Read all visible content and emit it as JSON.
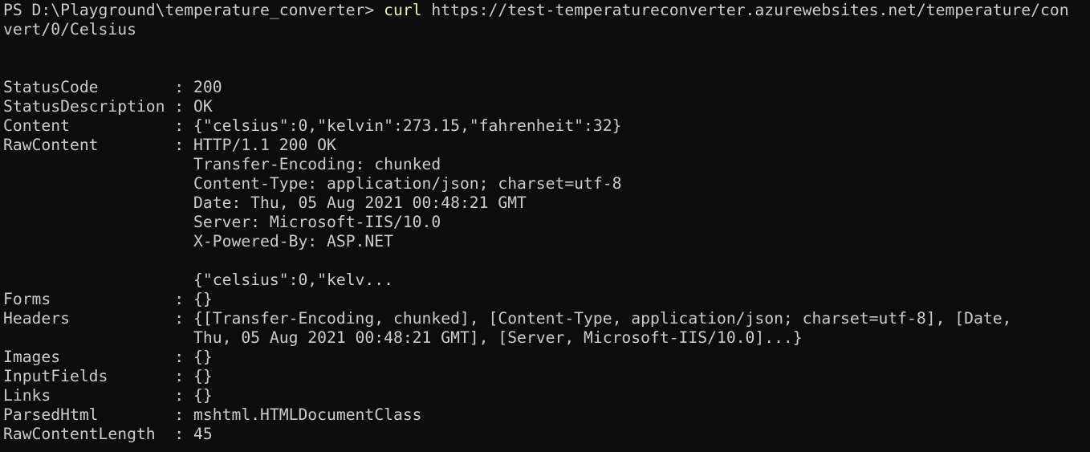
{
  "prompt": {
    "text": "PS D:\\Playground\\temperature_converter> ",
    "command": "curl",
    "url_line1": " https://test-temperatureconverter.azurewebsites.net/temperature/con",
    "url_line2": "vert/0/Celsius"
  },
  "output": [
    "StatusCode        : 200",
    "StatusDescription : OK",
    "Content           : {\"celsius\":0,\"kelvin\":273.15,\"fahrenheit\":32}",
    "RawContent        : HTTP/1.1 200 OK",
    "                    Transfer-Encoding: chunked",
    "                    Content-Type: application/json; charset=utf-8",
    "                    Date: Thu, 05 Aug 2021 00:48:21 GMT",
    "                    Server: Microsoft-IIS/10.0",
    "                    X-Powered-By: ASP.NET",
    "",
    "                    {\"celsius\":0,\"kelv...",
    "Forms             : {}",
    "Headers           : {[Transfer-Encoding, chunked], [Content-Type, application/json; charset=utf-8], [Date,",
    "                    Thu, 05 Aug 2021 00:48:21 GMT], [Server, Microsoft-IIS/10.0]...}",
    "Images            : {}",
    "InputFields       : {}",
    "Links             : {}",
    "ParsedHtml        : mshtml.HTMLDocumentClass",
    "RawContentLength  : 45"
  ],
  "colors": {
    "background": "#0c0c0c",
    "foreground": "#cccccc",
    "command": "#f9f1a5"
  }
}
